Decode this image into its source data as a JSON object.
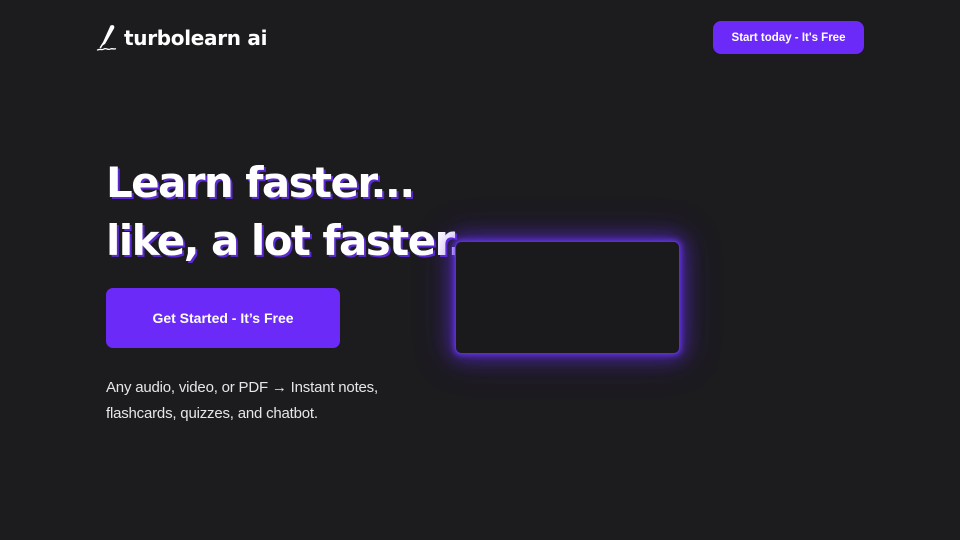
{
  "header": {
    "brand_name": "turbolearn ai",
    "brand_icon": "quill-pen-icon",
    "cta_label": "Start today - It's Free"
  },
  "hero": {
    "title_line1": "Learn faster...",
    "title_line2": "like, a lot faster.",
    "cta_label": "Get Started - It’s Free",
    "subtext_line1": "Any audio, video, or PDF → Instant notes,",
    "subtext_line2": "flashcards, quizzes, and chatbot."
  },
  "colors": {
    "background": "#1c1b1e",
    "accent": "#6b2af7",
    "glow": "#6e37ff",
    "text": "#ffffff"
  }
}
